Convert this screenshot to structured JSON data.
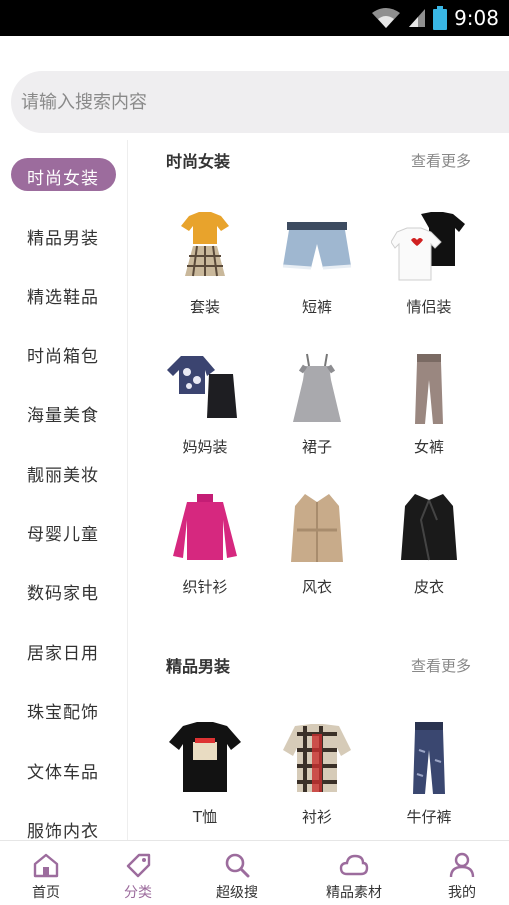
{
  "status_bar": {
    "time": "9:08"
  },
  "search": {
    "placeholder": "请输入搜索内容"
  },
  "sidebar": {
    "active_index": 0,
    "items": [
      {
        "label": "时尚女装"
      },
      {
        "label": "精品男装"
      },
      {
        "label": "精选鞋品"
      },
      {
        "label": "时尚箱包"
      },
      {
        "label": "海量美食"
      },
      {
        "label": "靓丽美妆"
      },
      {
        "label": "母婴儿童"
      },
      {
        "label": "数码家电"
      },
      {
        "label": "居家日用"
      },
      {
        "label": "珠宝配饰"
      },
      {
        "label": "文体车品"
      },
      {
        "label": "服饰内衣"
      }
    ]
  },
  "sections": [
    {
      "title": "时尚女装",
      "more": "查看更多",
      "items": [
        {
          "label": "套装",
          "icon": "tshirt-skirt-outfit-image"
        },
        {
          "label": "短裤",
          "icon": "denim-shorts-image"
        },
        {
          "label": "情侣装",
          "icon": "couple-tshirts-image"
        },
        {
          "label": "妈妈装",
          "icon": "floral-top-skirt-image"
        },
        {
          "label": "裙子",
          "icon": "dress-image"
        },
        {
          "label": "女裤",
          "icon": "women-pants-image"
        },
        {
          "label": "织针衫",
          "icon": "pink-sweater-image"
        },
        {
          "label": "风衣",
          "icon": "trench-coat-image"
        },
        {
          "label": "皮衣",
          "icon": "leather-jacket-image"
        }
      ]
    },
    {
      "title": "精品男装",
      "more": "查看更多",
      "items": [
        {
          "label": "T恤",
          "icon": "black-tshirt-image"
        },
        {
          "label": "衬衫",
          "icon": "plaid-shirt-image"
        },
        {
          "label": "牛仔裤",
          "icon": "jeans-image"
        }
      ]
    }
  ],
  "tabbar": {
    "active_index": 1,
    "items": [
      {
        "label": "首页",
        "icon": "home-icon"
      },
      {
        "label": "分类",
        "icon": "tag-icon"
      },
      {
        "label": "超级搜",
        "icon": "search-icon"
      },
      {
        "label": "精品素材",
        "icon": "cloud-icon"
      },
      {
        "label": "我的",
        "icon": "user-icon"
      }
    ]
  },
  "colors": {
    "accent": "#9c6c9d",
    "search_bg": "#efeef0"
  }
}
